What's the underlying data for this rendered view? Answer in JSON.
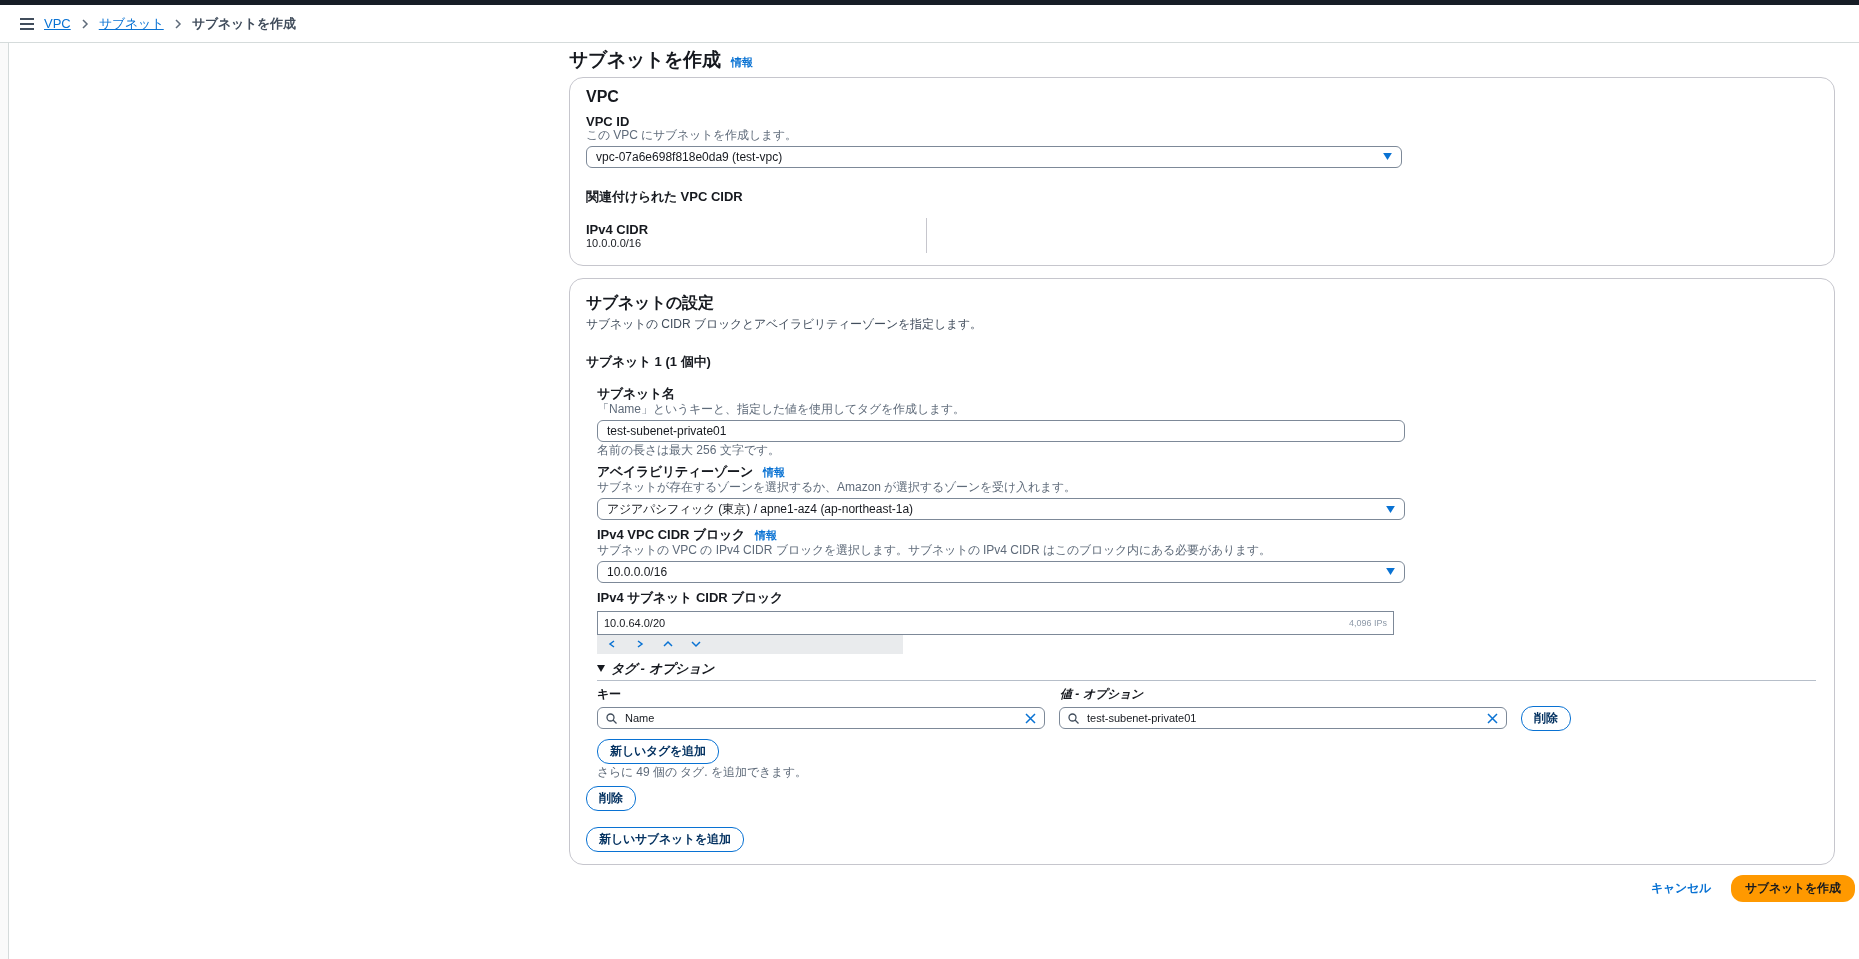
{
  "breadcrumb": [
    {
      "label": "VPC",
      "kind": "link"
    },
    {
      "label": "サブネット",
      "kind": "link"
    },
    {
      "label": "サブネットを作成",
      "kind": "current"
    }
  ],
  "page_title": "サブネットを作成",
  "info_link": "情報",
  "vpc_section": {
    "title": "VPC",
    "vpc_id": {
      "label": "VPC ID",
      "description": "この VPC にサブネットを作成します。",
      "value": "vpc-07a6e698f818e0da9 (test-vpc)"
    },
    "cidr_heading": "関連付けられた VPC CIDR",
    "cidr_columns": [
      {
        "label": "IPv4 CIDR",
        "value": "10.0.0.0/16"
      }
    ]
  },
  "subnet_section": {
    "title": "サブネットの設定",
    "description": "サブネットの CIDR ブロックとアベイラビリティーゾーンを指定します。",
    "subnets": [
      {
        "heading": "サブネット 1 (1 個中)",
        "fields": [
          {
            "kind": "text",
            "label": "サブネット名",
            "description": "「Name」というキーと、指定した値を使用してタグを作成します。",
            "value": "test-subenet-private01",
            "hint": "名前の長さは最大 256 文字です。"
          },
          {
            "kind": "select",
            "label": "アベイラビリティーゾーン",
            "info": "情報",
            "description": "サブネットが存在するゾーンを選択するか、Amazon が選択するゾーンを受け入れます。",
            "value": "アジアパシフィック (東京) / apne1-az4 (ap-northeast-1a)"
          },
          {
            "kind": "select",
            "label": "IPv4 VPC CIDR ブロック",
            "info": "情報",
            "description": "サブネットの VPC の IPv4 CIDR ブロックを選択します。サブネットの IPv4 CIDR はこのブロック内にある必要があります。",
            "value": "10.0.0.0/16"
          },
          {
            "kind": "cidr",
            "label": "IPv4 サブネット CIDR ブロック",
            "value": "10.0.64.0/20",
            "ip_count": "4,096 IPs"
          }
        ],
        "tags": {
          "title": "タグ - オプション",
          "expanded": true,
          "key_label": "キー",
          "value_label": "値 - オプション",
          "rows": [
            {
              "key": "Name",
              "value": "test-subenet-private01",
              "remove": "削除"
            }
          ],
          "add_button": "新しいタグを追加",
          "hint": "さらに 49 個の タグ. を追加できます。"
        },
        "remove_button": "削除"
      }
    ],
    "add_button": "新しいサブネットを追加"
  },
  "footer": {
    "cancel": "キャンセル",
    "submit": "サブネットを作成"
  }
}
